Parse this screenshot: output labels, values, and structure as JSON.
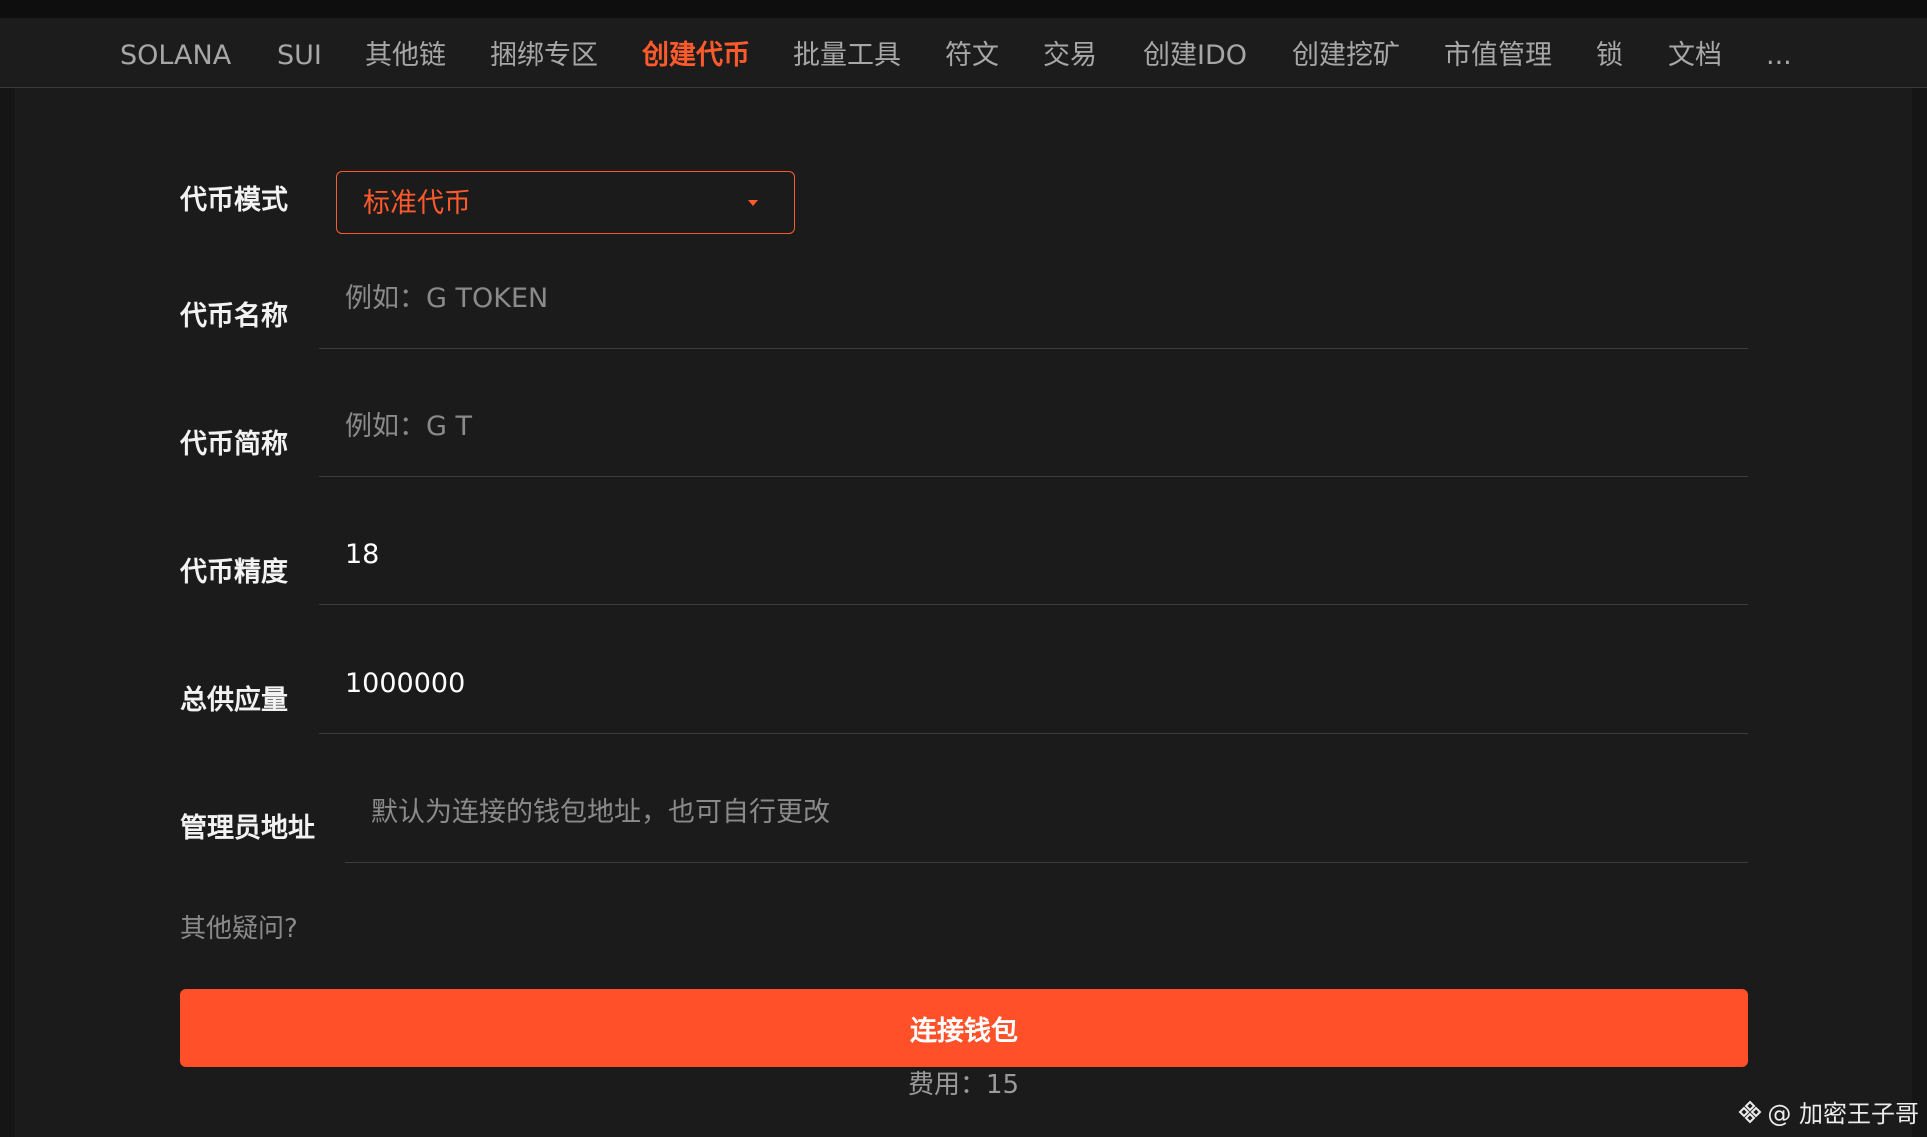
{
  "nav": {
    "items": [
      {
        "label": "SOLANA",
        "active": false
      },
      {
        "label": "SUI",
        "active": false
      },
      {
        "label": "其他链",
        "active": false
      },
      {
        "label": "捆绑专区",
        "active": false
      },
      {
        "label": "创建代币",
        "active": true
      },
      {
        "label": "批量工具",
        "active": false
      },
      {
        "label": "符文",
        "active": false
      },
      {
        "label": "交易",
        "active": false
      },
      {
        "label": "创建IDO",
        "active": false
      },
      {
        "label": "创建挖矿",
        "active": false
      },
      {
        "label": "市值管理",
        "active": false
      },
      {
        "label": "锁",
        "active": false
      },
      {
        "label": "文档",
        "active": false
      },
      {
        "label": "...",
        "active": false
      }
    ]
  },
  "form": {
    "mode": {
      "label": "代币模式",
      "value": "标准代币",
      "icon": "caret-down-icon"
    },
    "name": {
      "label": "代币名称",
      "value": "",
      "placeholder": "例如：G TOKEN"
    },
    "symbol": {
      "label": "代币简称",
      "value": "",
      "placeholder": "例如：G T"
    },
    "decimals": {
      "label": "代币精度",
      "value": "18",
      "placeholder": ""
    },
    "supply": {
      "label": "总供应量",
      "value": "1000000",
      "placeholder": ""
    },
    "admin": {
      "label": "管理员地址",
      "value": "",
      "placeholder": "默认为连接的钱包地址，也可自行更改"
    }
  },
  "help_text": "其他疑问?",
  "connect_button": "连接钱包",
  "fee_text": "费用：15",
  "watermark": {
    "text": "@ 加密王子哥",
    "icon": "binance-square-icon"
  },
  "colors": {
    "accent": "#ff5a2c",
    "background": "#1b1b1b",
    "nav_background": "#1c1c1c"
  }
}
